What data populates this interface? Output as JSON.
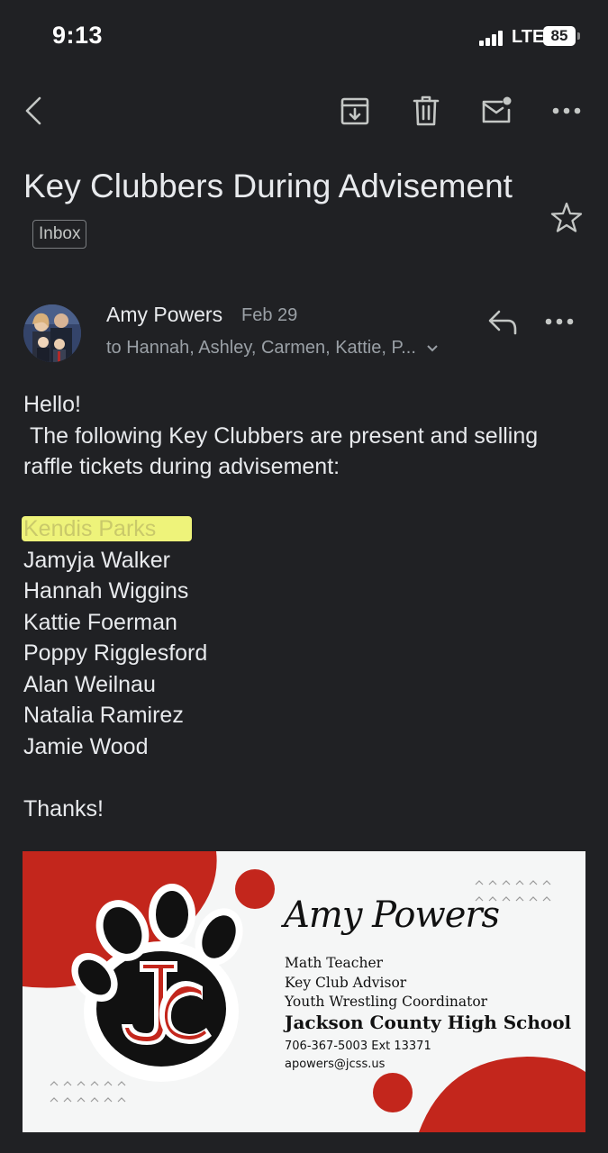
{
  "status": {
    "time": "9:13",
    "network": "LTE",
    "battery": "85"
  },
  "email": {
    "subject": "Key Clubbers During Advisement",
    "label": "Inbox",
    "sender": "Amy Powers",
    "date": "Feb 29",
    "recipients": "to Hannah, Ashley, Carmen, Kattie, P...",
    "greeting": "Hello!",
    "intro": " The following Key Clubbers are present and selling raffle tickets during advisement:",
    "highlighted_name": "Kendis Parks",
    "names": [
      "Jamyja Walker",
      "Hannah Wiggins",
      "Kattie Foerman",
      "Poppy Rigglesford",
      "Alan Weilnau",
      "Natalia Ramirez",
      "Jamie Wood"
    ],
    "closing": "Thanks!"
  },
  "signature": {
    "name": "Amy Powers",
    "role1": "Math Teacher",
    "role2": "Key Club Advisor",
    "role3": "Youth Wrestling Coordinator",
    "school": "Jackson County High School",
    "phone": "706-367-5003 Ext 13371",
    "email": "apowers@jcss.us",
    "accent_color": "#c3261c"
  },
  "icons": [
    "back-arrow-icon",
    "archive-icon",
    "trash-icon",
    "mark-unread-icon",
    "more-icon",
    "star-icon",
    "reply-icon"
  ]
}
